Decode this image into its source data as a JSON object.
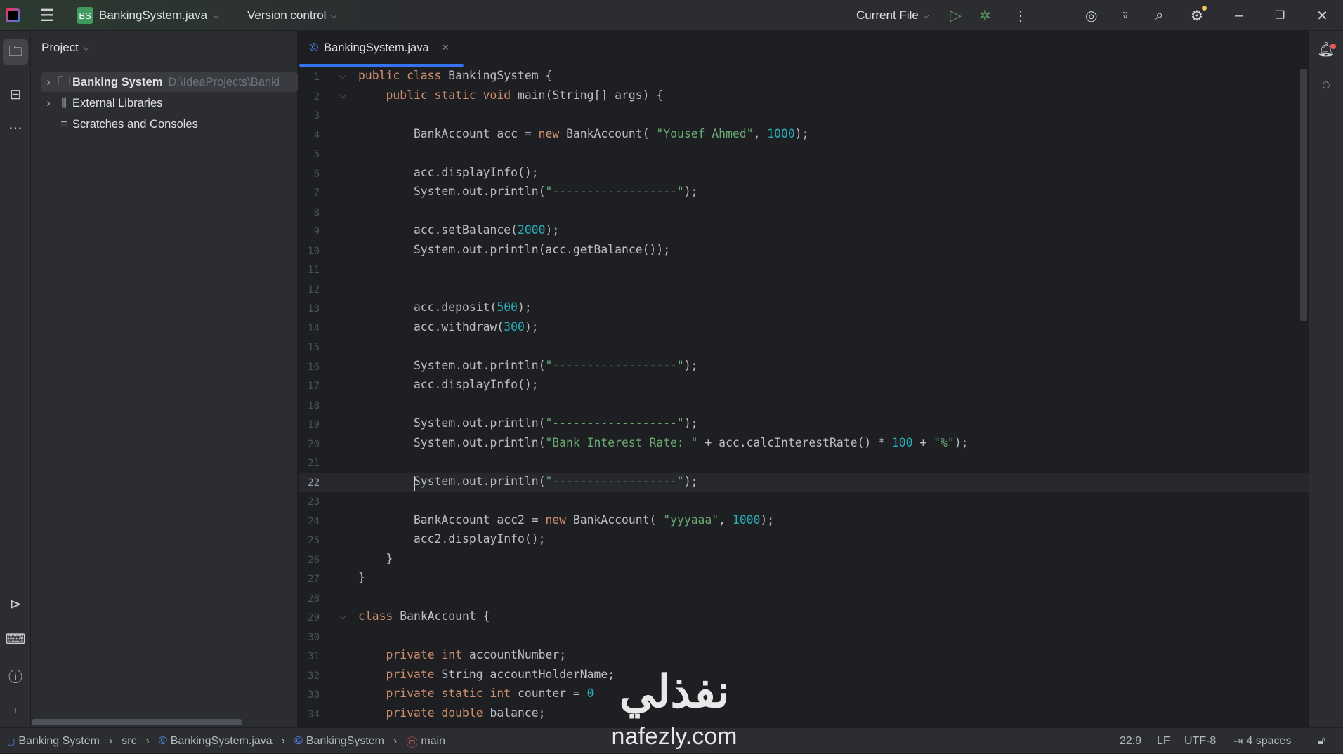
{
  "titlebar": {
    "project_badge": "BS",
    "project_name": "BankingSystem.java",
    "vcs": "Version control",
    "run_config": "Current File"
  },
  "project_panel": {
    "title": "Project",
    "items": [
      {
        "label": "Banking System",
        "path": "D:\\IdeaProjects\\Banki"
      },
      {
        "label": "External Libraries"
      },
      {
        "label": "Scratches and Consoles"
      }
    ]
  },
  "tab": {
    "label": "BankingSystem.java"
  },
  "editor": {
    "current_line": 22,
    "fold_lines": [
      1,
      2,
      29
    ],
    "lines": [
      [
        [
          "k",
          "public class "
        ],
        [
          "p",
          "BankingSystem {"
        ]
      ],
      [
        [
          "p",
          "    "
        ],
        [
          "k",
          "public static void "
        ],
        [
          "p",
          "main(String[] args) {"
        ]
      ],
      [],
      [
        [
          "p",
          "        BankAccount acc = "
        ],
        [
          "k",
          "new "
        ],
        [
          "p",
          "BankAccount( "
        ],
        [
          "s",
          "\"Yousef Ahmed\""
        ],
        [
          "p",
          ", "
        ],
        [
          "n",
          "1000"
        ],
        [
          "p",
          ");"
        ]
      ],
      [],
      [
        [
          "p",
          "        acc.displayInfo();"
        ]
      ],
      [
        [
          "p",
          "        System.out.println("
        ],
        [
          "s",
          "\"------------------\""
        ],
        [
          "p",
          ");"
        ]
      ],
      [],
      [
        [
          "p",
          "        acc.setBalance("
        ],
        [
          "n",
          "2000"
        ],
        [
          "p",
          ");"
        ]
      ],
      [
        [
          "p",
          "        System.out.println(acc.getBalance());"
        ]
      ],
      [],
      [],
      [
        [
          "p",
          "        acc.deposit("
        ],
        [
          "n",
          "500"
        ],
        [
          "p",
          ");"
        ]
      ],
      [
        [
          "p",
          "        acc.withdraw("
        ],
        [
          "n",
          "300"
        ],
        [
          "p",
          ");"
        ]
      ],
      [],
      [
        [
          "p",
          "        System.out.println("
        ],
        [
          "s",
          "\"------------------\""
        ],
        [
          "p",
          ");"
        ]
      ],
      [
        [
          "p",
          "        acc.displayInfo();"
        ]
      ],
      [],
      [
        [
          "p",
          "        System.out.println("
        ],
        [
          "s",
          "\"------------------\""
        ],
        [
          "p",
          ");"
        ]
      ],
      [
        [
          "p",
          "        System.out.println("
        ],
        [
          "s",
          "\"Bank Interest Rate: \""
        ],
        [
          "p",
          " + acc.calcInterestRate() * "
        ],
        [
          "n",
          "100"
        ],
        [
          "p",
          " + "
        ],
        [
          "s",
          "\"%\""
        ],
        [
          "p",
          ");"
        ]
      ],
      [],
      [
        [
          "p",
          "        System.out.println("
        ],
        [
          "s",
          "\"------------------\""
        ],
        [
          "p",
          ");"
        ]
      ],
      [],
      [
        [
          "p",
          "        BankAccount acc2 = "
        ],
        [
          "k",
          "new "
        ],
        [
          "p",
          "BankAccount( "
        ],
        [
          "s",
          "\"yyyaaa\""
        ],
        [
          "p",
          ", "
        ],
        [
          "n",
          "1000"
        ],
        [
          "p",
          ");"
        ]
      ],
      [
        [
          "p",
          "        acc2.displayInfo();"
        ]
      ],
      [
        [
          "p",
          "    }"
        ]
      ],
      [
        [
          "p",
          "}"
        ]
      ],
      [],
      [
        [
          "k",
          "class "
        ],
        [
          "p",
          "BankAccount {"
        ]
      ],
      [],
      [
        [
          "p",
          "    "
        ],
        [
          "k",
          "private int "
        ],
        [
          "p",
          "accountNumber;"
        ]
      ],
      [
        [
          "p",
          "    "
        ],
        [
          "k",
          "private "
        ],
        [
          "p",
          "String accountHolderName;"
        ]
      ],
      [
        [
          "p",
          "    "
        ],
        [
          "k",
          "private static int "
        ],
        [
          "p",
          "counter = "
        ],
        [
          "n",
          "0"
        ]
      ],
      [
        [
          "p",
          "    "
        ],
        [
          "k",
          "private double "
        ],
        [
          "p",
          "balance;"
        ]
      ]
    ]
  },
  "statusbar": {
    "breadcrumbs": [
      "Banking System",
      "src",
      "BankingSystem.java",
      "BankingSystem",
      "main"
    ],
    "position": "22:9",
    "line_sep": "LF",
    "encoding": "UTF-8",
    "indent": "4 spaces"
  },
  "watermark": {
    "arabic": "نفذلي",
    "latin": "nafezly.com"
  }
}
